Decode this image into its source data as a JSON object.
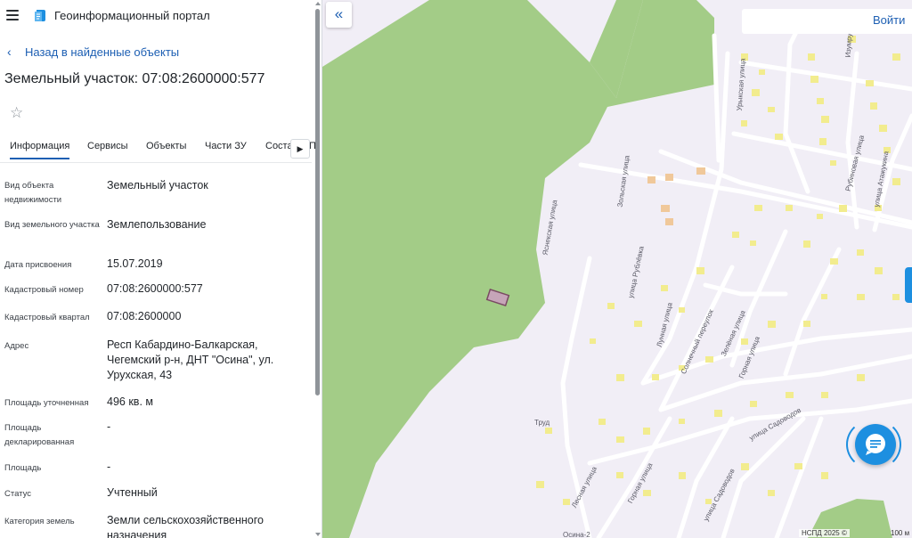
{
  "header": {
    "app_title": "Геоинформационный портал"
  },
  "nav": {
    "back_label": "Назад в найденные объекты"
  },
  "object": {
    "title": "Земельный участок: 07:08:2600000:577"
  },
  "tabs": [
    {
      "label": "Информация",
      "active": true
    },
    {
      "label": "Сервисы"
    },
    {
      "label": "Объекты"
    },
    {
      "label": "Части ЗУ"
    },
    {
      "label": "Соста"
    },
    {
      "label": "П"
    }
  ],
  "attributes": [
    {
      "label": "Вид объекта недвижимости",
      "value": "Земельный участок"
    },
    {
      "label": "Вид земельного участка",
      "value": "Землепользование"
    },
    {
      "label": "Дата присвоения",
      "value": "15.07.2019"
    },
    {
      "label": "Кадастровый номер",
      "value": "07:08:2600000:577"
    },
    {
      "label": "Кадастровый квартал",
      "value": "07:08:2600000"
    },
    {
      "label": "Адрес",
      "value": "Респ Кабардино-Балкарская, Чегемский р-н, ДНТ \"Осина\", ул. Урухская, 43"
    },
    {
      "label": "Площадь уточненная",
      "value": "496 кв. м"
    },
    {
      "label": "Площадь декларированная",
      "value": "-"
    },
    {
      "label": "Площадь",
      "value": "-"
    },
    {
      "label": "Статус",
      "value": "Учтенный"
    },
    {
      "label": "Категория земель",
      "value": "Земли сельскохозяйственного назначения"
    }
  ],
  "map": {
    "login_label": "Войти",
    "copyright": "НСПД 2025 ©",
    "scale": "100 м",
    "street_labels": [
      "Изумрудная",
      "Урыкская улица",
      "Зольская улица",
      "Рубиновая улица",
      "улица Атажукина",
      "Яснекская улица",
      "улица Рублёвка",
      "Лунная улица",
      "Солнечный переулок",
      "Зелёная улица",
      "Горная улица",
      "Труд",
      "улица Садоводов",
      "Лесная улица",
      "Горная улица",
      "улица Садоводов",
      "Осина-2"
    ],
    "colors": {
      "forest": "#a3cc87",
      "land": "#f1eef6",
      "building": "#f2ec8e",
      "road": "#ffffff",
      "accent": "#1d8fe0"
    }
  },
  "icons": {
    "menu": "hamburger-icon",
    "logo": "portal-logo-icon",
    "back": "chevron-left-icon",
    "favorite": "star-outline-icon",
    "tabs_next": "chevron-right-icon",
    "collapse": "double-chevron-left-icon",
    "chat": "chat-bubble-icon"
  }
}
